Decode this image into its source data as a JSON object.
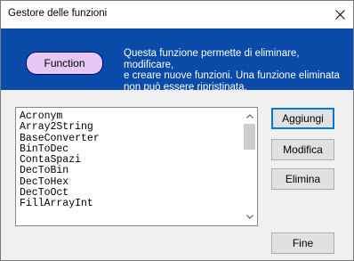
{
  "window": {
    "title": "Gestore delle funzioni"
  },
  "banner": {
    "badge_label": "Function",
    "description_lines": [
      "Questa funzione permette di eliminare, modificare,",
      "e creare nuove funzioni. Una funzione eliminata",
      "non può essere ripristinata."
    ],
    "background_color": "#0a4aa8",
    "badge_color": "#e7c8f3"
  },
  "function_list": {
    "items": [
      "Acronym",
      "Array2String",
      "BaseConverter",
      "BinToDec",
      "ContaSpazi",
      "DecToBin",
      "DecToHex",
      "DecToOct",
      "FillArrayInt"
    ]
  },
  "buttons": {
    "add": "Aggiungi",
    "edit": "Modifica",
    "delete": "Elimina",
    "finish": "Fine"
  },
  "icons": {
    "close": "close-icon",
    "scroll_up": "chevron-up-icon",
    "scroll_down": "chevron-down-icon"
  }
}
